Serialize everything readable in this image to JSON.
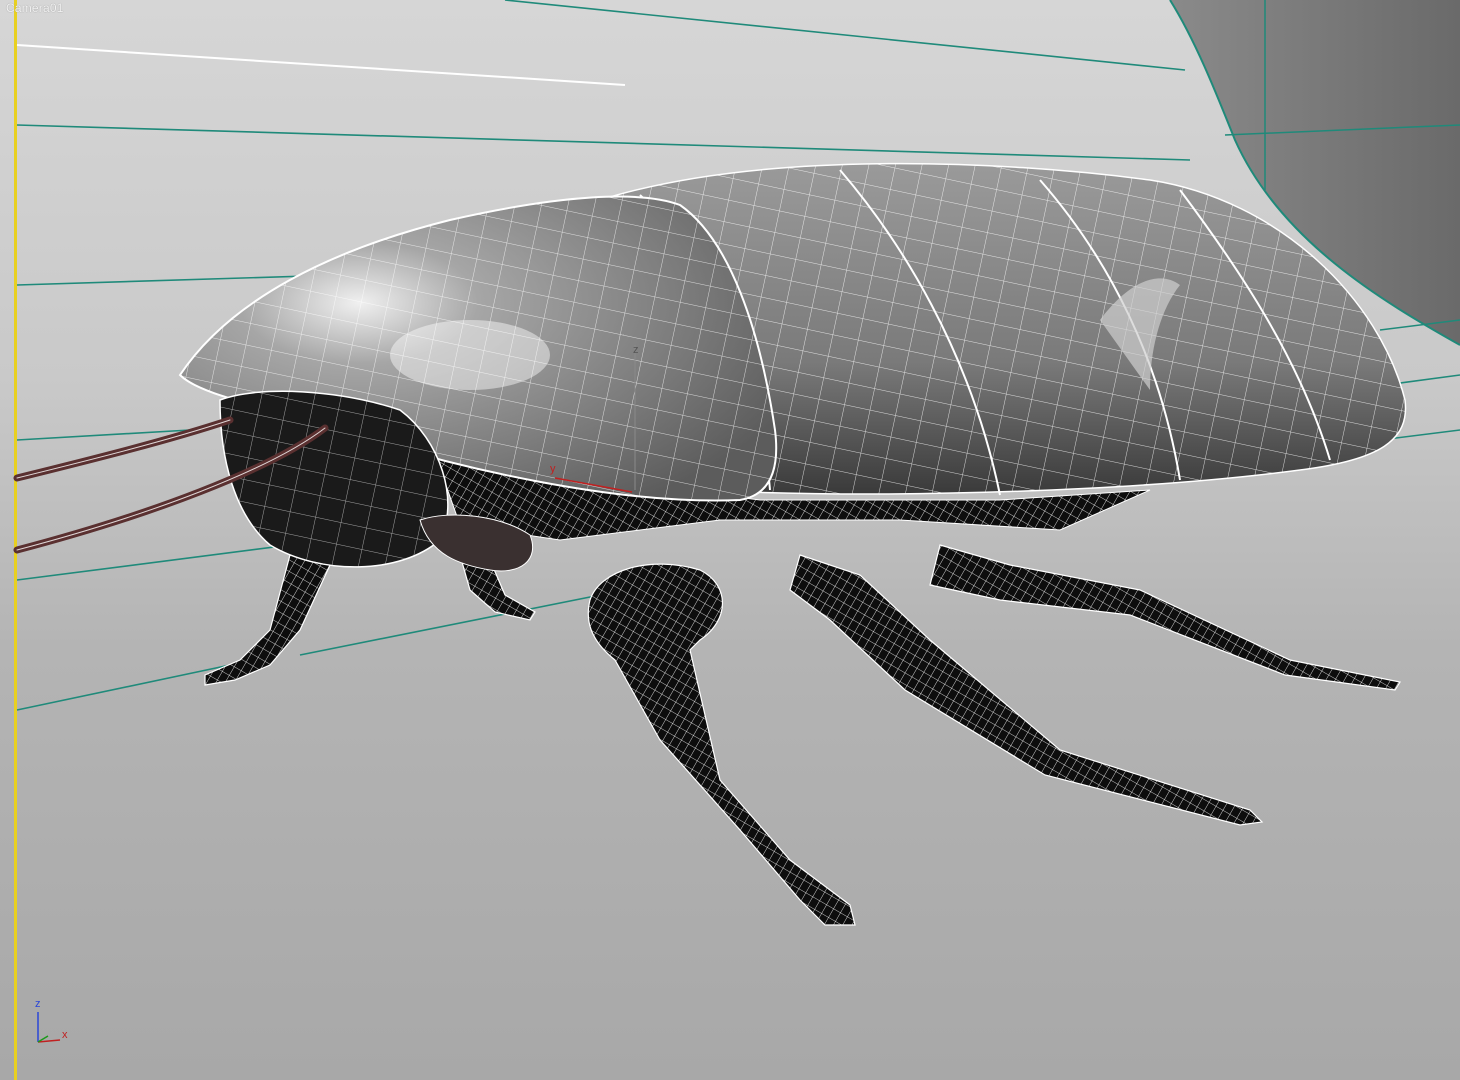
{
  "viewport": {
    "label": "Camera01",
    "border_color": "#e8d020",
    "background_color": "#c4c4c4"
  },
  "scene": {
    "subject": "cockroach wireframe mesh",
    "wire_color": "#ffffff",
    "body_shade": "#8a8a8a",
    "leg_shade": "#111111",
    "guide_line_color": "#1f8a7a",
    "antenna_color": "#5a3030"
  },
  "gizmo": {
    "z_label": "z",
    "x_label": "x",
    "pivot_z_label": "z",
    "pivot_y_label": "y",
    "z_color": "#2a46d8",
    "x_color": "#c02020",
    "y_color": "#1a9a1a"
  }
}
